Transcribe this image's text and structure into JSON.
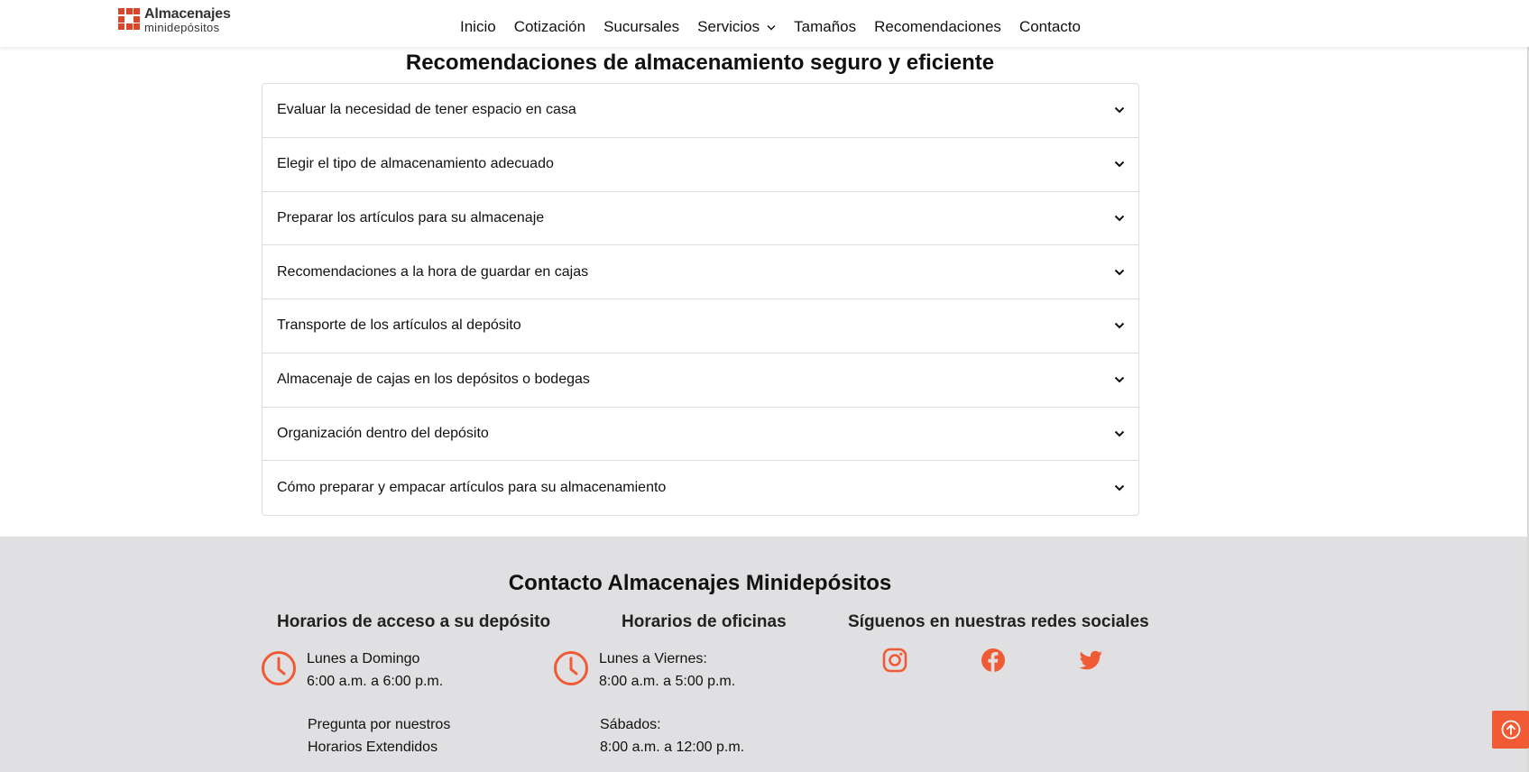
{
  "header": {
    "logo": {
      "main": "Almacenajes",
      "sub": "minidepósitos"
    },
    "nav": [
      {
        "label": "Inicio"
      },
      {
        "label": "Cotización"
      },
      {
        "label": "Sucursales"
      },
      {
        "label": "Servicios",
        "dropdown": true
      },
      {
        "label": "Tamaños"
      },
      {
        "label": "Recomendaciones"
      },
      {
        "label": "Contacto"
      }
    ]
  },
  "main": {
    "title": "Recomendaciones de almacenamiento seguro y eficiente",
    "accordion": [
      {
        "label": "Evaluar la necesidad de tener espacio en casa"
      },
      {
        "label": "Elegir el tipo de almacenamiento adecuado"
      },
      {
        "label": "Preparar los artículos para su almacenaje"
      },
      {
        "label": "Recomendaciones a la hora de guardar en cajas"
      },
      {
        "label": "Transporte de los artículos al depósito"
      },
      {
        "label": "Almacenaje de cajas en los depósitos o bodegas"
      },
      {
        "label": "Organización dentro del depósito"
      },
      {
        "label": "Cómo preparar y empacar artículos para su almacenamiento"
      }
    ]
  },
  "footer": {
    "title": "Contacto Almacenajes Minidepósitos",
    "access": {
      "heading": "Horarios de acceso a su depósito",
      "line1": "Lunes a Domingo",
      "line2": "6:00 a.m. a 6:00 p.m.",
      "line3": "Pregunta por nuestros",
      "line4": "Horarios Extendidos"
    },
    "offices": {
      "heading": "Horarios de oficinas",
      "line1": "Lunes a Viernes:",
      "line2": "8:00 a.m. a 5:00 p.m.",
      "line3": "Sábados:",
      "line4": "8:00 a.m. a 12:00 p.m."
    },
    "social": {
      "heading": "Síguenos en nuestras redes sociales",
      "icons": [
        "instagram-icon",
        "facebook-icon",
        "twitter-icon"
      ]
    }
  },
  "colors": {
    "accent": "#f05a35",
    "footer_bg": "#e0e0e2",
    "logo": "#d9472b"
  }
}
